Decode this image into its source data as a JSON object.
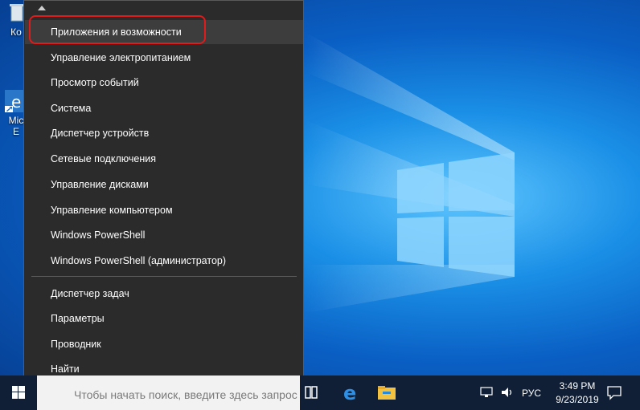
{
  "desktop": {
    "icons": [
      {
        "name": "recycle-bin",
        "label": "Ко"
      },
      {
        "name": "edge-shortcut",
        "label_line1": "Mic",
        "label_line2": "E"
      }
    ]
  },
  "context_menu": {
    "items_group1": [
      "Приложения и возможности",
      "Управление электропитанием",
      "Просмотр событий",
      "Система",
      "Диспетчер устройств",
      "Сетевые подключения",
      "Управление дисками",
      "Управление компьютером",
      "Windows PowerShell",
      "Windows PowerShell (администратор)"
    ],
    "items_group2": [
      "Диспетчер задач",
      "Параметры",
      "Проводник",
      "Найти"
    ],
    "highlighted_item": "Приложения и возможности",
    "highlight_color": "#e01b1b"
  },
  "taskbar": {
    "search_placeholder": "Чтобы начать поиск, введите здесь запрос",
    "pinned": [
      "task-view-icon",
      "edge-icon",
      "file-explorer-icon"
    ],
    "tray": {
      "language": "РУС",
      "time": "3:49 PM",
      "date": "9/23/2019"
    }
  },
  "colors": {
    "menu_bg": "#2b2b2b",
    "taskbar_bg": "#101f35",
    "accent": "#0a7ad8"
  }
}
